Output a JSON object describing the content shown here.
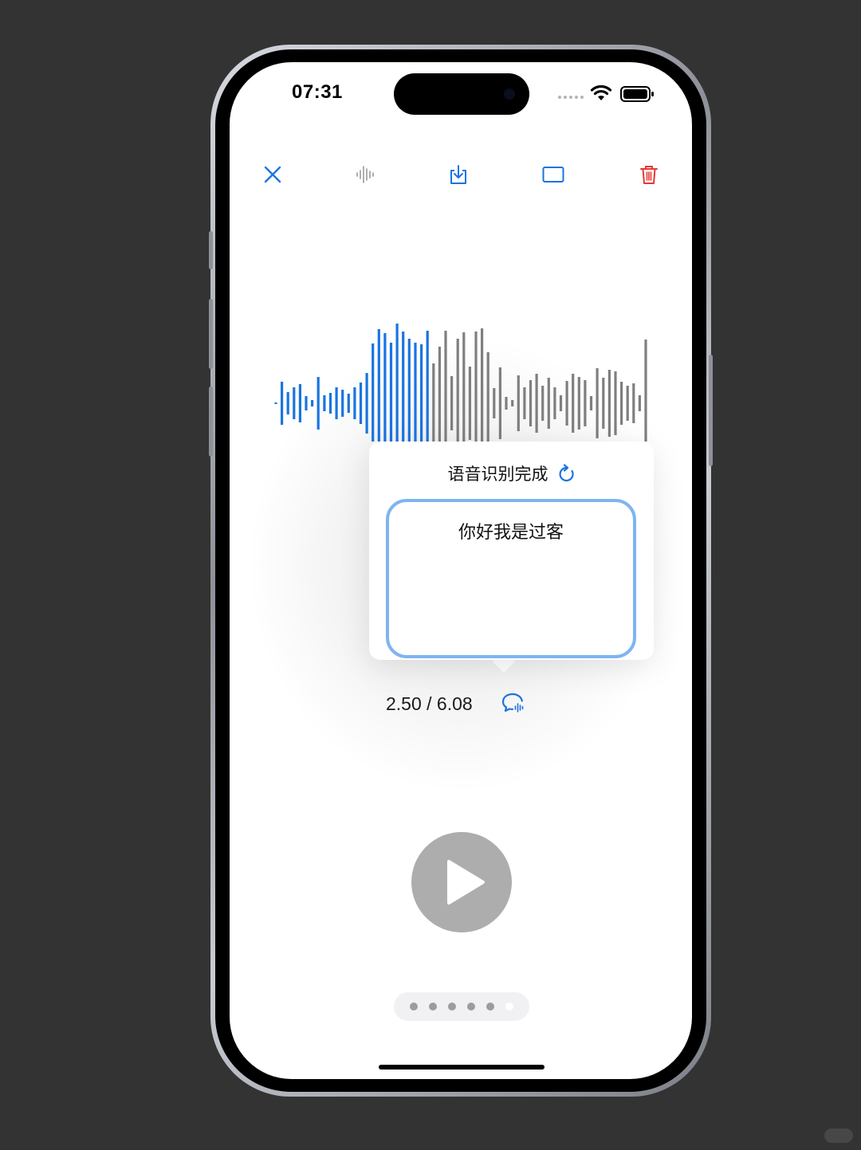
{
  "status_bar": {
    "time": "07:31"
  },
  "toolbar": {
    "close_icon": "close-icon",
    "waveform_icon": "waveform-icon",
    "download_icon": "download-icon",
    "frame_icon": "rectangle-icon",
    "delete_icon": "trash-icon"
  },
  "waveform": {
    "played_fraction": 0.41,
    "played_color": "#1a74e0",
    "unplayed_color": "#7f7f7f"
  },
  "popup": {
    "title": "语音识别完成",
    "transcript": "你好我是过客"
  },
  "playback": {
    "readout": "2.50 / 6.08"
  },
  "pager": {
    "count": 6,
    "active_index": 5
  },
  "colors": {
    "accent": "#1a74e0",
    "delete": "#e53935",
    "background": "#333333"
  }
}
